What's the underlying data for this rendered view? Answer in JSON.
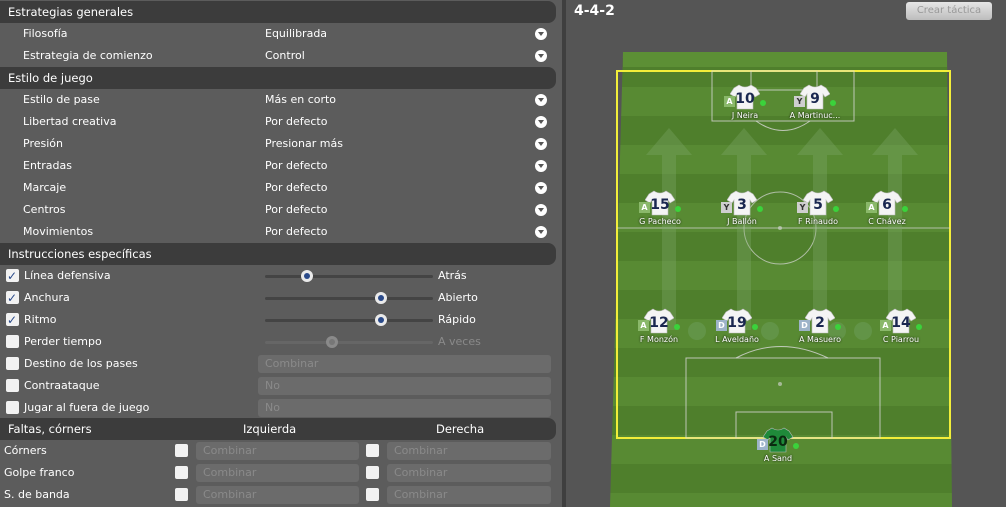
{
  "left": {
    "general_header": "Estrategias generales",
    "general_rows": [
      {
        "label": "Filosofía",
        "value": "Equilibrada"
      },
      {
        "label": "Estrategia de comienzo",
        "value": "Control"
      }
    ],
    "style_header": "Estilo de juego",
    "style_rows": [
      {
        "label": "Estilo de pase",
        "value": "Más en corto"
      },
      {
        "label": "Libertad creativa",
        "value": "Por defecto"
      },
      {
        "label": "Presión",
        "value": "Presionar más"
      },
      {
        "label": "Entradas",
        "value": "Por defecto"
      },
      {
        "label": "Marcaje",
        "value": "Por defecto"
      },
      {
        "label": "Centros",
        "value": "Por defecto"
      },
      {
        "label": "Movimientos",
        "value": "Por defecto"
      }
    ],
    "specific_header": "Instrucciones específicas",
    "sliders": [
      {
        "label": "Línea defensiva",
        "checked": true,
        "value": 0.25,
        "text": "Atrás"
      },
      {
        "label": "Anchura",
        "checked": true,
        "value": 0.69,
        "text": "Abierto"
      },
      {
        "label": "Ritmo",
        "checked": true,
        "value": 0.69,
        "text": "Rápido"
      },
      {
        "label": "Perder tiempo",
        "checked": false,
        "value": 0.4,
        "text": "A veces"
      }
    ],
    "selects": [
      {
        "label": "Destino de los pases",
        "value": "Combinar"
      },
      {
        "label": "Contraataque",
        "value": "No"
      },
      {
        "label": "Jugar al fuera de juego",
        "value": "No"
      }
    ],
    "fouls_header": "Faltas, córners",
    "left_col": "Izquierda",
    "right_col": "Derecha",
    "set_pieces": [
      {
        "label": "Córners",
        "left": "Combinar",
        "right": "Combinar"
      },
      {
        "label": "Golpe franco",
        "left": "Combinar",
        "right": "Combinar"
      },
      {
        "label": "S. de banda",
        "left": "Combinar",
        "right": "Combinar"
      }
    ]
  },
  "right": {
    "formation": "4-4-2",
    "create_button": "Crear táctica",
    "players": [
      {
        "num": "10",
        "name": "J Neira",
        "role": "A"
      },
      {
        "num": "9",
        "name": "A Martinuc...",
        "role": "Y"
      },
      {
        "num": "15",
        "name": "G Pacheco",
        "role": "A"
      },
      {
        "num": "3",
        "name": "J Ballón",
        "role": "Y"
      },
      {
        "num": "5",
        "name": "F Rinaudo",
        "role": "Y"
      },
      {
        "num": "6",
        "name": "C Chávez",
        "role": "A"
      },
      {
        "num": "12",
        "name": "F Monzón",
        "role": "A"
      },
      {
        "num": "19",
        "name": "L Aveldaño",
        "role": "D"
      },
      {
        "num": "2",
        "name": "A Masuero",
        "role": "D"
      },
      {
        "num": "14",
        "name": "C Piarrou",
        "role": "A"
      },
      {
        "num": "20",
        "name": "A Sand",
        "role": "D"
      }
    ]
  }
}
